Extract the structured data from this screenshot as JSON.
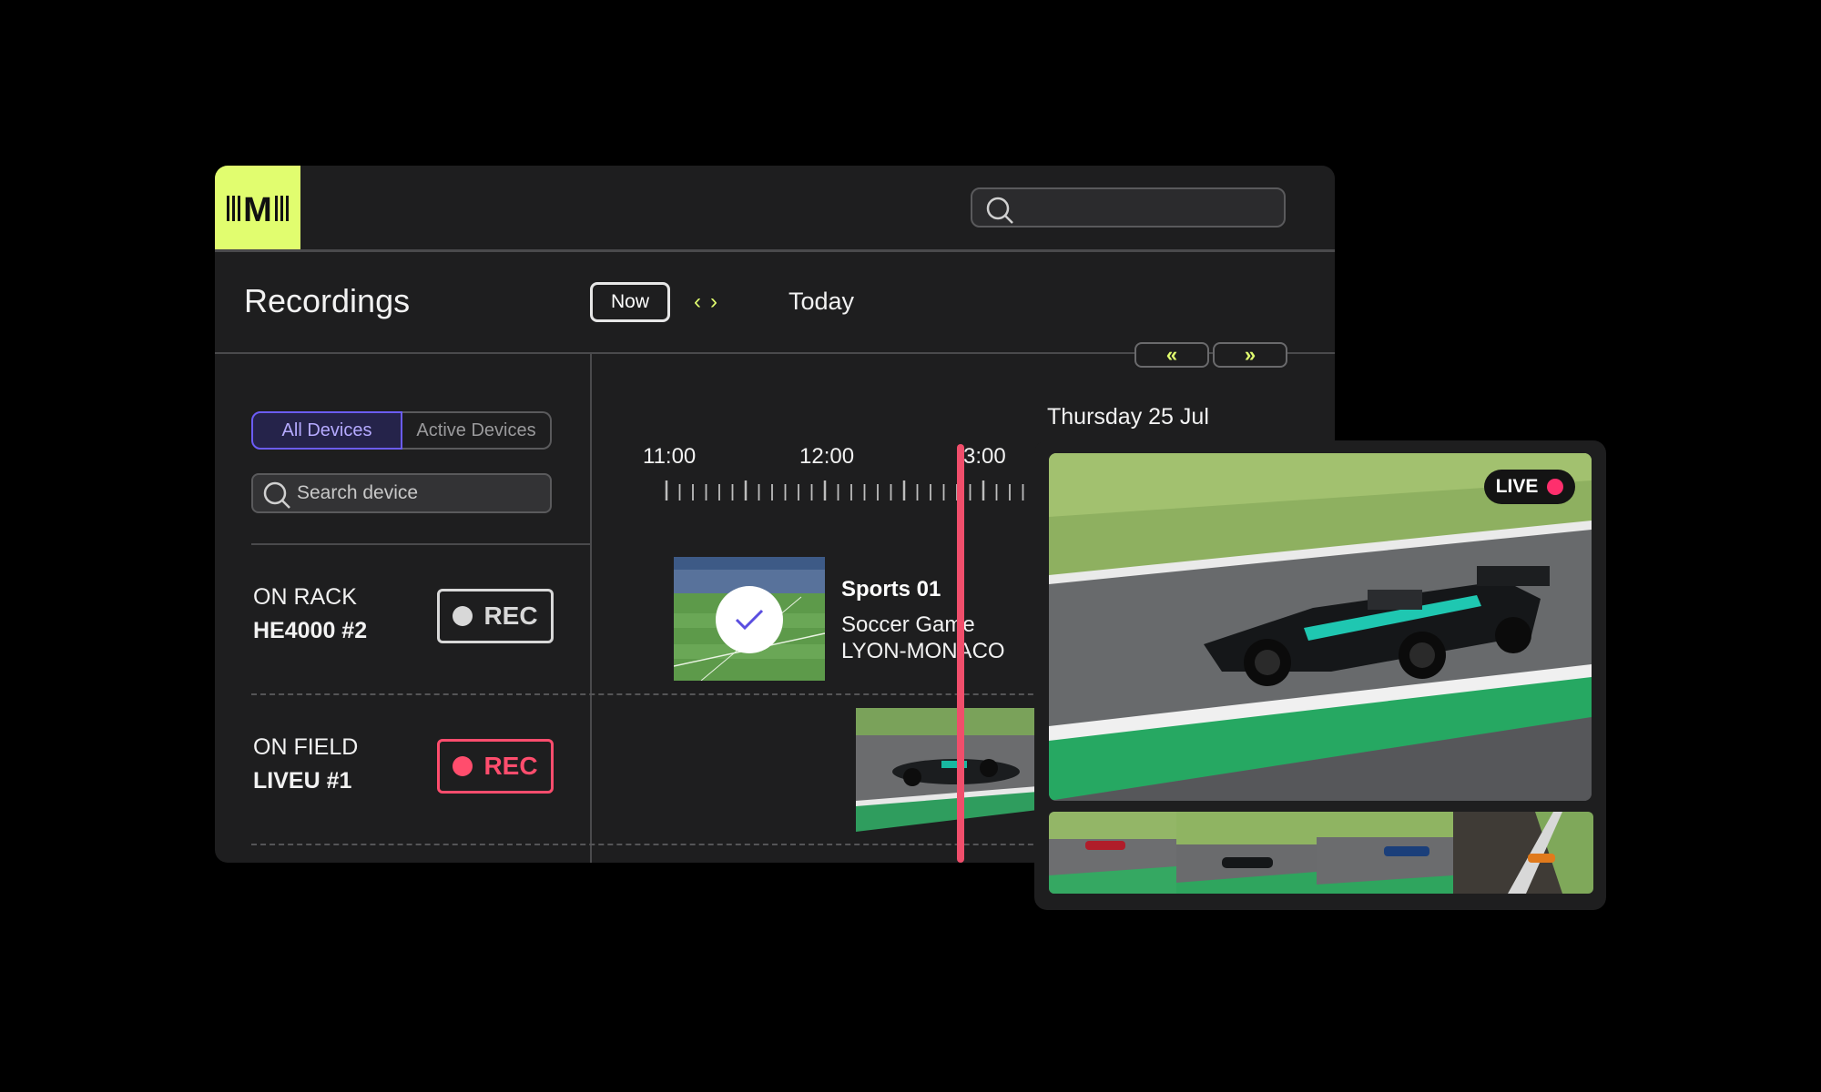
{
  "app": {
    "logo_text": "M",
    "colors": {
      "accent": "#e1fd6f",
      "selection": "#6b5cf6",
      "record": "#ff4d6d",
      "playhead": "#f04e6b"
    }
  },
  "search": {
    "placeholder": ""
  },
  "header": {
    "title": "Recordings",
    "now_label": "Now",
    "prev_icon": "chevron-left-icon",
    "next_icon": "chevron-right-icon",
    "day_label": "Today",
    "page_prev_label": "«",
    "page_next_label": "»"
  },
  "sidebar": {
    "tabs": [
      {
        "label": "All Devices",
        "selected": true
      },
      {
        "label": "Active Devices",
        "selected": false
      }
    ],
    "search_placeholder": "Search device",
    "devices": [
      {
        "location": "ON RACK",
        "name": "HE4000 #2",
        "rec_label": "REC",
        "recording": false
      },
      {
        "location": "ON FIELD",
        "name": "LIVEU #1",
        "rec_label": "REC",
        "recording": true
      }
    ]
  },
  "timeline": {
    "date": "Thursday 25 Jul",
    "times": [
      "11:00",
      "12:00",
      "3:00"
    ]
  },
  "programs": [
    {
      "channel": "Sports 01",
      "title_line1": "Soccer Game",
      "title_line2": "LYON-MONACO",
      "status_icon": "check-icon"
    }
  ],
  "live": {
    "badge": "LIVE"
  }
}
